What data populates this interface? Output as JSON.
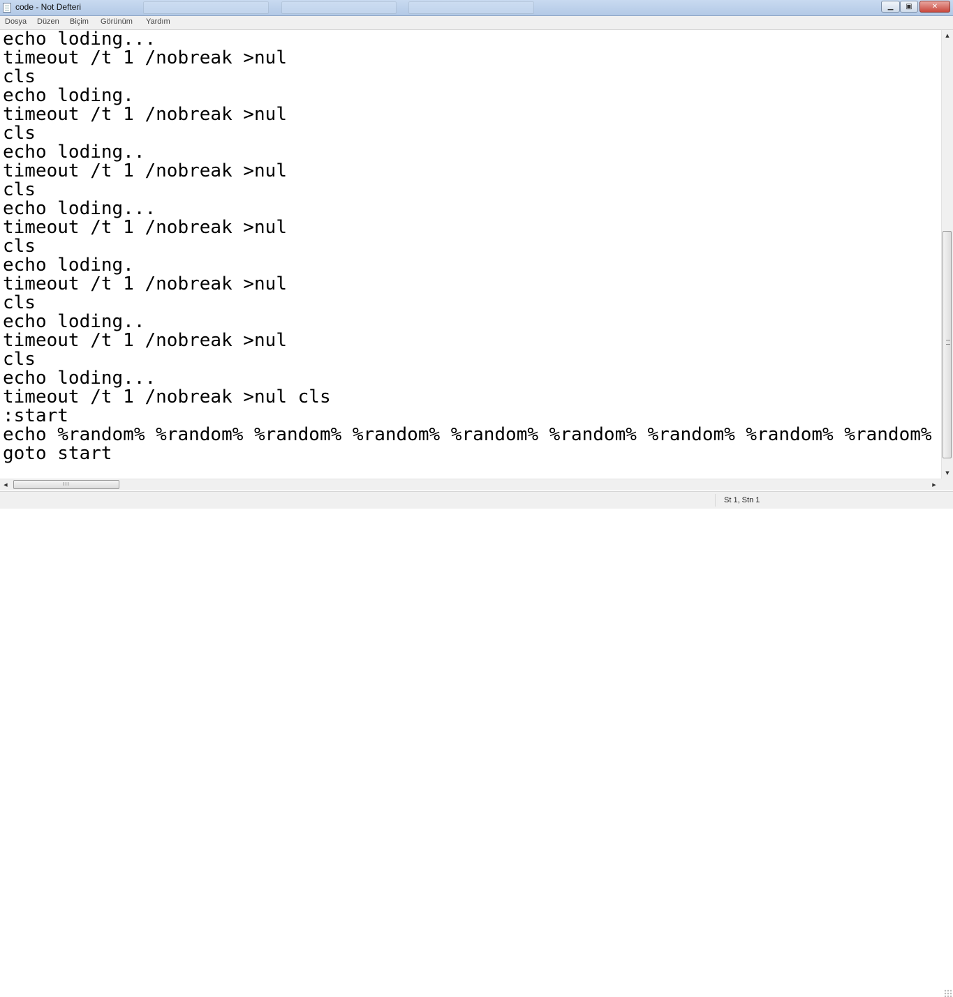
{
  "window": {
    "title": "code - Not Defteri",
    "app_icon": "notepad-icon",
    "controls": {
      "minimize": "▁",
      "maximize": "▣",
      "close": "✕"
    }
  },
  "menu": {
    "items": [
      "Dosya",
      "Düzen",
      "Biçim",
      "Görünüm",
      "Yardım"
    ]
  },
  "editor": {
    "lines": [
      "echo loding...",
      "timeout /t 1 /nobreak >nul",
      "cls",
      "echo loding.",
      "timeout /t 1 /nobreak >nul",
      "cls",
      "echo loding..",
      "timeout /t 1 /nobreak >nul",
      "cls",
      "echo loding...",
      "timeout /t 1 /nobreak >nul",
      "cls",
      "echo loding.",
      "timeout /t 1 /nobreak >nul",
      "cls",
      "echo loding..",
      "timeout /t 1 /nobreak >nul",
      "cls",
      "echo loding...",
      "timeout /t 1 /nobreak >nul cls",
      ":start",
      "echo %random% %random% %random% %random% %random% %random% %random% %random% %random%",
      "goto start"
    ]
  },
  "scrollbars": {
    "up_arrow": "▲",
    "down_arrow": "▼",
    "left_arrow": "◀",
    "right_arrow": "▶",
    "h_grip": "III"
  },
  "status": {
    "position": "St 1, Stn 1"
  }
}
